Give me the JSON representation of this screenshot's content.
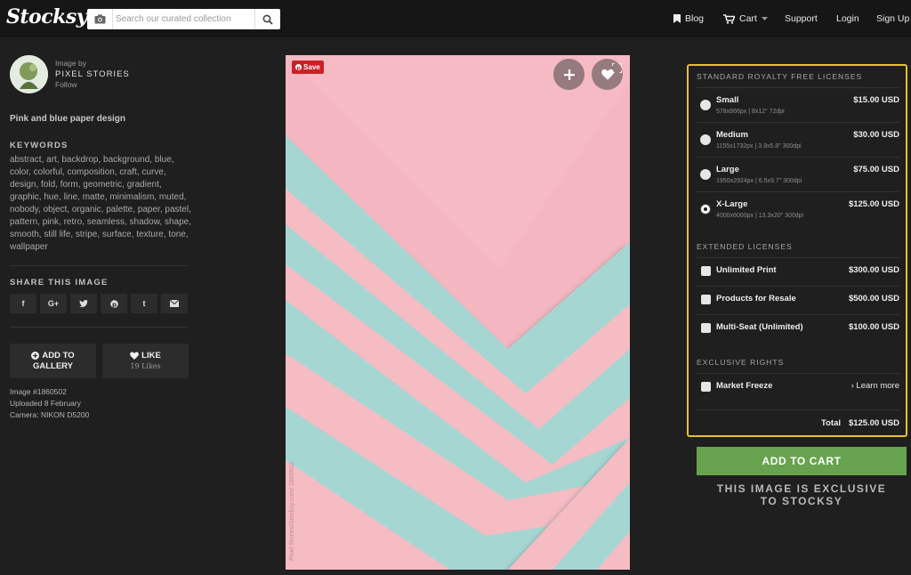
{
  "header": {
    "logo": "Stocksy",
    "search_placeholder": "Search our curated collection",
    "nav": {
      "blog": "Blog",
      "cart": "Cart",
      "support": "Support",
      "login": "Login",
      "signup": "Sign Up"
    }
  },
  "author": {
    "label": "Image by",
    "name": "PIXEL STORIES",
    "follow": "Follow"
  },
  "image": {
    "title": "Pink and blue paper design",
    "watermark": "Pixel Stories/Stocksy.com/ 1860502",
    "save_label": "Save",
    "colors": {
      "pink": "#f5bcc4",
      "blue": "#a6d6d2",
      "shadow": "#5a7f86"
    }
  },
  "keywords": {
    "heading": "KEYWORDS",
    "text": "abstract, art, backdrop, background, blue, color, colorful, composition, craft, curve, design, fold, form, geometric, gradient, graphic, hue, line, matte, minimalism, muted, nobody, object, organic, palette, paper, pastel, pattern, pink, retro, seamless, shadow, shape, smooth, still life, stripe, surface, texture, tone, wallpaper"
  },
  "share": {
    "heading": "SHARE THIS IMAGE",
    "buttons": [
      "f",
      "G+",
      "twitter",
      "pinterest",
      "t",
      "mail"
    ]
  },
  "actions": {
    "add_line1": "ADD TO",
    "add_line2": "GALLERY",
    "like": "LIKE",
    "likes_count": "19 Likes"
  },
  "meta": {
    "image_id": "Image #1860502",
    "uploaded": "Uploaded 8 February",
    "camera": "Camera: NIKON D5200"
  },
  "licenses": {
    "standard_heading": "STANDARD ROYALTY FREE LICENSES",
    "standard": [
      {
        "name": "Small",
        "dims": "578x866px | 8x12\" 72dpi",
        "price": "$15.00 USD",
        "selected": false
      },
      {
        "name": "Medium",
        "dims": "1155x1732px | 3.9x5.8\" 300dpi",
        "price": "$30.00 USD",
        "selected": false
      },
      {
        "name": "Large",
        "dims": "1950x2924px | 6.5x9.7\" 300dpi",
        "price": "$75.00 USD",
        "selected": false
      },
      {
        "name": "X-Large",
        "dims": "4000x6000px | 13.3x20\" 300dpi",
        "price": "$125.00 USD",
        "selected": true
      }
    ],
    "extended_heading": "EXTENDED LICENSES",
    "extended": [
      {
        "name": "Unlimited Print",
        "price": "$300.00 USD"
      },
      {
        "name": "Products for Resale",
        "price": "$500.00 USD"
      },
      {
        "name": "Multi-Seat (Unlimited)",
        "price": "$100.00 USD"
      }
    ],
    "exclusive_heading": "EXCLUSIVE RIGHTS",
    "exclusive": {
      "name": "Market Freeze",
      "link": "› Learn more"
    },
    "total_label": "Total",
    "total_value": "$125.00 USD",
    "highlight_color": "#e7c22a"
  },
  "cart": {
    "button": "ADD TO CART",
    "color": "#67a34e",
    "exclusive_line1": "THIS IMAGE IS EXCLUSIVE",
    "exclusive_line2": "TO STOCKSY"
  }
}
